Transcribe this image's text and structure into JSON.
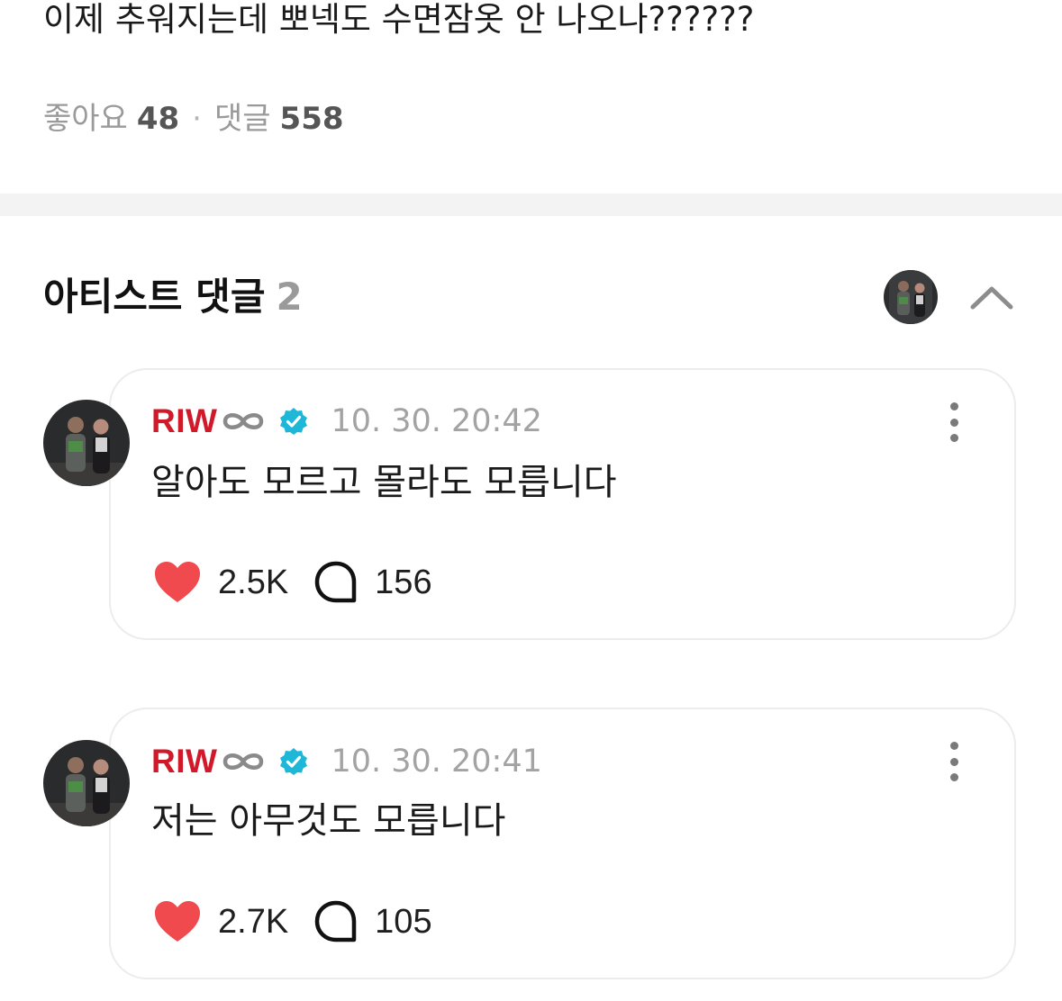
{
  "post": {
    "text": "이제 추워지는데 뽀넥도 수면잠옷 안 나오나??????",
    "likes_label": "좋아요",
    "likes_count": "48",
    "separator": "·",
    "comments_label": "댓글",
    "comments_count": "558"
  },
  "artist_comments": {
    "title": "아티스트 댓글",
    "count": "2"
  },
  "comments": [
    {
      "author": "RIW",
      "timestamp": "10. 30. 20:42",
      "text": "알아도 모르고 몰라도 모릅니다",
      "likes": "2.5K",
      "replies": "156"
    },
    {
      "author": "RIW",
      "timestamp": "10. 30. 20:41",
      "text": "저는 아무것도 모릅니다",
      "likes": "2.7K",
      "replies": "105"
    }
  ],
  "icons": {
    "heart": "heart-icon",
    "reply": "speech-bubble-icon",
    "verified": "verified-badge-icon",
    "more": "more-vertical-icon",
    "collapse": "chevron-up-icon",
    "logo_mark": "infinity-icon"
  },
  "colors": {
    "artist_name": "#d1192a",
    "verified_badge": "#1fb7d8",
    "heart": "#f04a4f",
    "muted_text": "#9a9a9a",
    "divider": "#f3f3f3"
  }
}
